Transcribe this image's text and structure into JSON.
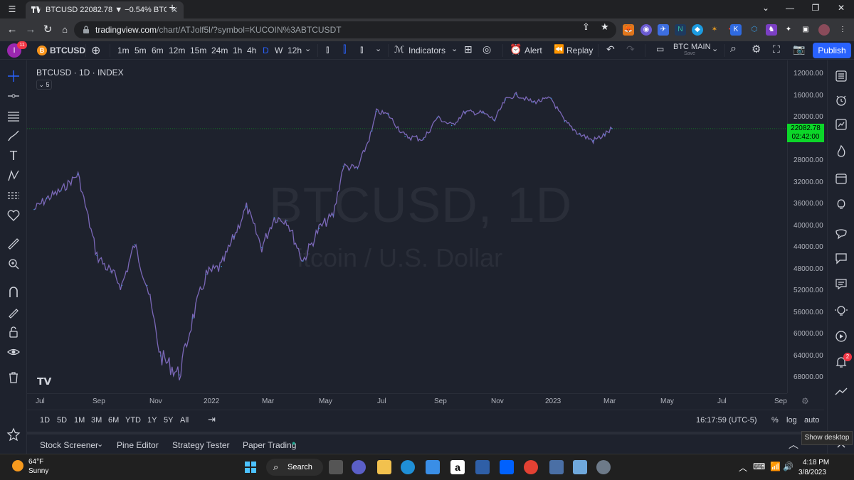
{
  "browser": {
    "tab_title": "BTCUSD 22082.78 ▼ −0.54% BTC",
    "new_tab": "+",
    "url_host": "tradingview.com",
    "url_path": "/chart/ATJolf5l/?symbol=KUCOIN%3ABTCUSDT",
    "window_controls": [
      "⌄",
      "—",
      "❐",
      "✕"
    ]
  },
  "toolbar": {
    "avatar_letter": "I",
    "avatar_badge": "11",
    "symbol": "BTCUSD",
    "intervals": [
      "1m",
      "5m",
      "6m",
      "12m",
      "15m",
      "24m",
      "1h",
      "4h",
      "D",
      "W",
      "12h"
    ],
    "active_interval": "D",
    "indicators_label": "Indicators",
    "alert_label": "Alert",
    "replay_label": "Replay",
    "layout_name": "BTC MAIN",
    "layout_sub": "Save",
    "publish_label": "Publish"
  },
  "legend": {
    "title": "BTCUSD · 1D · INDEX",
    "collapse": "⌄ 5"
  },
  "watermark": {
    "symbol": "BTCUSD, 1D",
    "description": "itcoin / U.S. Dollar"
  },
  "price_tag": {
    "price": "22082.78",
    "countdown": "02:42:00",
    "color": "#0cd629"
  },
  "chart_data": {
    "type": "line",
    "title": "BTCUSD · 1D · INDEX",
    "y_scale": "inverted",
    "y_ticks": [
      "12000.00",
      "16000.00",
      "20000.00",
      "24000.00",
      "28000.00",
      "32000.00",
      "36000.00",
      "40000.00",
      "44000.00",
      "48000.00",
      "52000.00",
      "56000.00",
      "60000.00",
      "64000.00",
      "68000.00"
    ],
    "x_ticks": [
      "Jul",
      "Sep",
      "Nov",
      "2022",
      "Mar",
      "May",
      "Jul",
      "Sep",
      "Nov",
      "2023",
      "Mar",
      "May",
      "Jul",
      "Sep"
    ],
    "ylim": [
      12000,
      68000
    ],
    "series": [
      {
        "color": "#7b68b8",
        "x": [
          "2021-06-01",
          "2021-06-15",
          "2021-07-01",
          "2021-07-20",
          "2021-08-10",
          "2021-08-25",
          "2021-09-07",
          "2021-09-21",
          "2021-10-05",
          "2021-10-20",
          "2021-11-10",
          "2021-11-25",
          "2021-12-10",
          "2021-12-27",
          "2022-01-10",
          "2022-01-24",
          "2022-02-10",
          "2022-02-24",
          "2022-03-10",
          "2022-03-28",
          "2022-04-15",
          "2022-05-01",
          "2022-05-12",
          "2022-05-28",
          "2022-06-13",
          "2022-06-18",
          "2022-07-01",
          "2022-07-20",
          "2022-08-10",
          "2022-08-25",
          "2022-09-10",
          "2022-09-25",
          "2022-10-15",
          "2022-10-28",
          "2022-11-09",
          "2022-11-21",
          "2022-12-10",
          "2022-12-30",
          "2023-01-14",
          "2023-01-31",
          "2023-02-15",
          "2023-02-28",
          "2023-03-08"
        ],
        "y": [
          37000,
          35000,
          33500,
          30500,
          45500,
          48500,
          51000,
          43500,
          51000,
          64000,
          67500,
          57000,
          49000,
          47500,
          42000,
          36500,
          44000,
          38500,
          39000,
          46500,
          40500,
          38000,
          29000,
          29500,
          22500,
          18900,
          19500,
          23500,
          24000,
          20000,
          21500,
          19000,
          19200,
          20500,
          16800,
          15800,
          17200,
          16500,
          20800,
          23100,
          24300,
          23200,
          22082.78
        ]
      }
    ],
    "last_price": 22082.78
  },
  "xaxis_ticks": [
    "Jul",
    "Sep",
    "Nov",
    "2022",
    "Mar",
    "May",
    "Jul",
    "Sep",
    "Nov",
    "2023",
    "Mar",
    "May",
    "Jul",
    "Sep"
  ],
  "range_bar": {
    "ranges": [
      "1D",
      "5D",
      "1M",
      "3M",
      "6M",
      "YTD",
      "1Y",
      "5Y",
      "All"
    ],
    "time": "16:17:59 (UTC-5)",
    "percent": "%",
    "log": "log",
    "auto": "auto"
  },
  "panel_tabs": [
    "Stock Screener",
    "Pine Editor",
    "Strategy Tester",
    "Paper Trading"
  ],
  "right_widgets": {
    "badge": "2",
    "tooltip": "Show desktop"
  },
  "taskbar": {
    "temp": "64°F",
    "condition": "Sunny",
    "search_label": "Search",
    "time": "4:18 PM",
    "date": "3/8/2023"
  }
}
